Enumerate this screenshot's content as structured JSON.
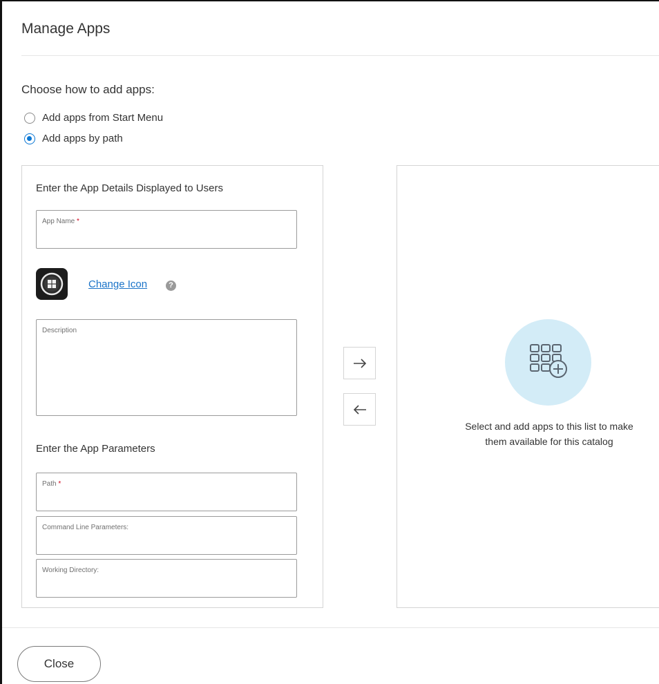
{
  "dialog": {
    "title": "Manage Apps"
  },
  "add_method": {
    "prompt": "Choose how to add apps:",
    "options": [
      {
        "label": "Add apps from Start Menu",
        "selected": false
      },
      {
        "label": "Add apps by path",
        "selected": true
      }
    ]
  },
  "details": {
    "section_title": "Enter the App Details Displayed to Users",
    "app_name_label": "App Name",
    "required_marker": "*",
    "change_icon_label": "Change Icon",
    "help_glyph": "?",
    "description_label": "Description"
  },
  "parameters": {
    "section_title": "Enter the App Parameters",
    "path_label": "Path",
    "command_line_label": "Command Line Parameters:",
    "working_directory_label": "Working Directory:"
  },
  "transfer": {
    "add_glyph": "→",
    "remove_glyph": "←"
  },
  "selected_list": {
    "empty_line1": "Select and add apps to this list to make",
    "empty_line2": "them available for this catalog"
  },
  "footer": {
    "close_label": "Close"
  },
  "colors": {
    "accent": "#0a77d4",
    "link": "#1a73c8",
    "required": "#d0021b",
    "empty_circle": "#d3ecf7",
    "panel_border": "#d4d4d4"
  },
  "icons": {
    "app_icon": "windows-app-icon",
    "help": "help-icon",
    "add_arrow": "arrow-right-icon",
    "remove_arrow": "arrow-left-icon",
    "empty_state": "app-grid-add-icon"
  }
}
